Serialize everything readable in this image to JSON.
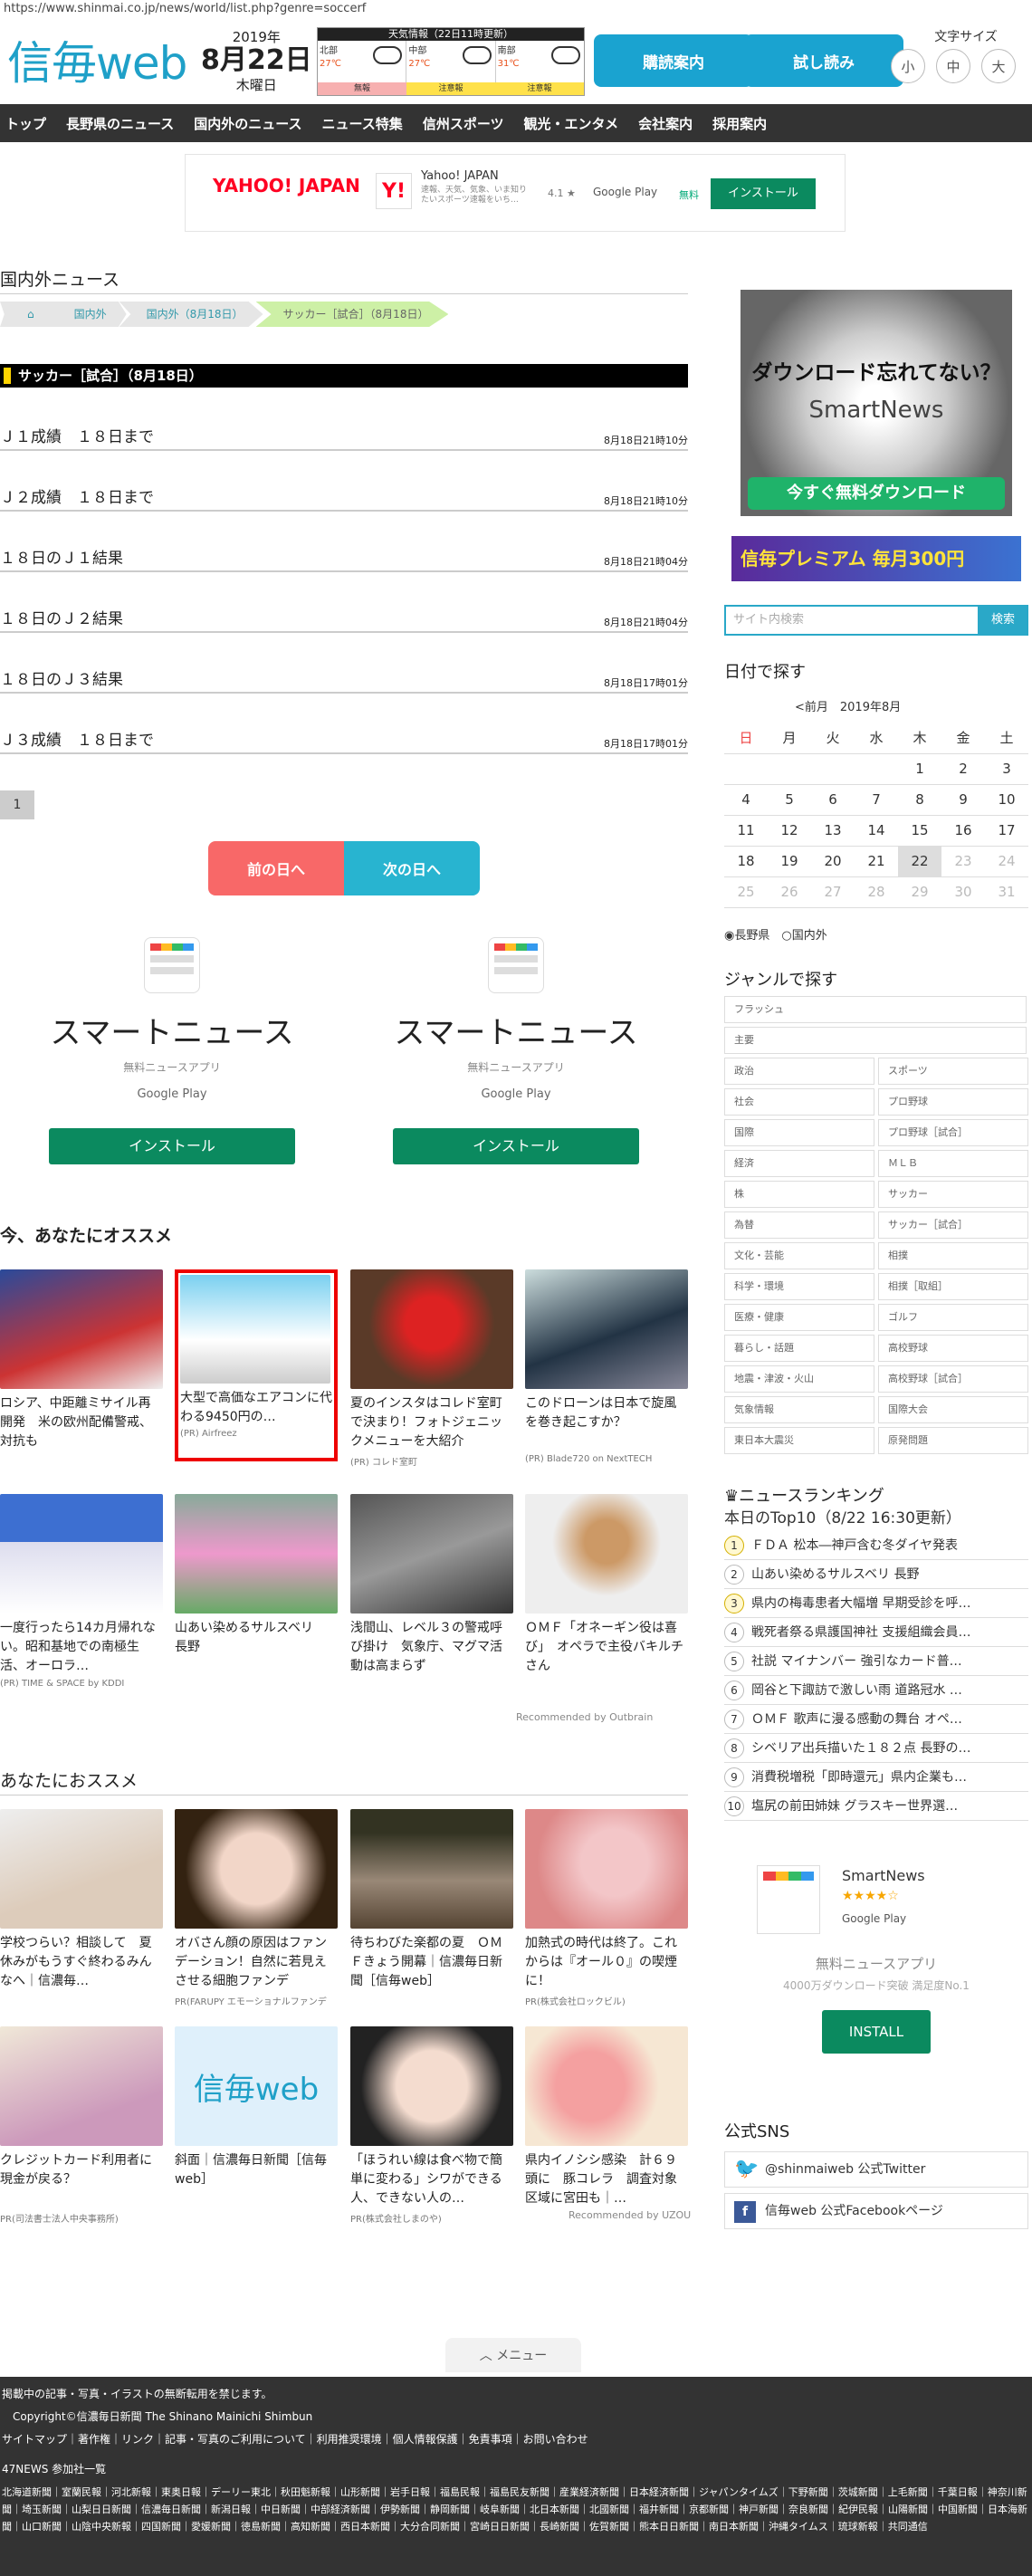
{
  "url": "https://www.shinmai.co.jp/news/world/list.php?genre=soccerf",
  "header": {
    "logo": "信毎web",
    "date_year": "2019年",
    "date_md": "8月22日",
    "date_wd": "木曜日",
    "weather_title": "天気情報（22日11時更新）",
    "weather": [
      {
        "area": "北部",
        "temp": "27℃",
        "warn": "無報"
      },
      {
        "area": "中部",
        "temp": "27℃",
        "warn": "注意報"
      },
      {
        "area": "南部",
        "temp": "31℃",
        "warn": "注意報"
      }
    ],
    "btn_sub": "購読案内",
    "btn_trial": "試し読み",
    "fontsize_label": "文字サイズ",
    "fs_small": "小",
    "fs_mid": "中",
    "fs_large": "大"
  },
  "nav": [
    "トップ",
    "長野県のニュース",
    "国内外のニュース",
    "ニュース特集",
    "信州スポーツ",
    "観光・エンタメ",
    "会社案内",
    "採用案内"
  ],
  "ad_banner": {
    "brand": "YAHOO! JAPAN",
    "app": "Yahoo! JAPAN",
    "desc": "速報、天気、気象、いま知りたいスポーツ速報をいち…",
    "rating": "4.1 ★",
    "store": "Google Play",
    "free": "無料",
    "install": "インストール"
  },
  "main": {
    "section": "国内外ニュース",
    "crumbs": [
      "国内外",
      "国内外（8月18日）",
      "サッカー［試合］（8月18日）"
    ],
    "category_bar": "サッカー［試合］（8月18日）",
    "articles": [
      {
        "title": "Ｊ１成績　１８日まで",
        "date": "8月18日21時10分"
      },
      {
        "title": "Ｊ２成績　１８日まで",
        "date": "8月18日21時10分"
      },
      {
        "title": "１８日のＪ１結果",
        "date": "8月18日21時04分"
      },
      {
        "title": "１８日のＪ２結果",
        "date": "8月18日21時04分"
      },
      {
        "title": "１８日のＪ３結果",
        "date": "8月18日17時01分"
      },
      {
        "title": "Ｊ３成績　１８日まで",
        "date": "8月18日17時01分"
      }
    ],
    "page": "1",
    "prev": "前の日へ",
    "next": "次の日へ",
    "smartnews_ad": {
      "title": "スマートニュース",
      "sub": "無料ニュースアプリ",
      "store": "Google Play",
      "install": "インストール"
    },
    "recommend_title": "今、あなたにオススメ",
    "recommend": [
      {
        "title": "ロシア、中距離ミサイル再開発　米の欧州配備警戒、対抗も",
        "src": ""
      },
      {
        "title": "大型で高価なエアコンに代わる9450円の…",
        "src": "(PR) Airfreez"
      },
      {
        "title": "夏のインスタはコレド室町で決まり！フォトジェニックメニューを大紹介",
        "src": "(PR) コレド室町"
      },
      {
        "title": "このドローンは日本で旋風を巻き起こすか？",
        "src": "(PR) Blade720 on NextTECH"
      },
      {
        "title": "一度行ったら14カ月帰れない。昭和基地での南極生活、オーロラ…",
        "src": "(PR) TIME & SPACE by KDDI"
      },
      {
        "title": "山あい染めるサルスベリ　長野",
        "src": ""
      },
      {
        "title": "浅間山、レベル３の警戒呼び掛け　気象庁、マグマ活動は高まらず",
        "src": ""
      },
      {
        "title": "ＯＭＦ「オネーギン役は喜び」　オペラで主役バキルチさん",
        "src": ""
      }
    ],
    "outbrain": "Recommended by Outbrain",
    "recommend2_title": "あなたにおススメ",
    "recommend2": [
      {
        "title": "学校つらい？相談して　夏休みがもうすぐ終わるみんなへ｜信濃毎…",
        "src": ""
      },
      {
        "title": "オバさん顔の原因はファンデーション！自然に若見えさせる細胞ファンデ",
        "src": "PR(FARUPY エモーショナルファンデ"
      },
      {
        "title": "待ちわびた楽都の夏　ＯＭＦきょう開幕｜信濃毎日新聞［信毎web］",
        "src": ""
      },
      {
        "title": "加熱式の時代は終了。これからは『オール０』の喫煙に！",
        "src": "PR(株式会社ロックビル)"
      },
      {
        "title": "クレジットカード利用者に現金が戻る？",
        "src": "PR(司法書士法人中央事務所)"
      },
      {
        "title": "斜面｜信濃毎日新聞［信毎web］",
        "src": ""
      },
      {
        "title": "「ほうれい線は食べ物で簡単に変わる」シワができる人、できない人の…",
        "src": "PR(株式会社しまのや)"
      },
      {
        "title": "県内イノシシ感染　計６９頭に　豚コレラ　調査対象区域に宮田も｜…",
        "src": ""
      }
    ],
    "uzou": "Recommended by UZOU",
    "menu": "メニュー"
  },
  "side": {
    "sn_ad_title": "ダウンロード忘れてない？",
    "sn_ad_brand": "SmartNews",
    "sn_ad_btn": "今すぐ無料ダウンロード",
    "premium": "信毎プレミアム 毎月300円",
    "search_placeholder": "サイト内検索",
    "search_btn": "検索",
    "date_search": "日付で探す",
    "cal_nav": "<前月　2019年8月",
    "cal_head": [
      "日",
      "月",
      "火",
      "水",
      "木",
      "金",
      "土"
    ],
    "cal_rows": [
      [
        "",
        "",
        "",
        "",
        "1",
        "2",
        "3"
      ],
      [
        "4",
        "5",
        "6",
        "7",
        "8",
        "9",
        "10"
      ],
      [
        "11",
        "12",
        "13",
        "14",
        "15",
        "16",
        "17"
      ],
      [
        "18",
        "19",
        "20",
        "21",
        "22",
        "23",
        "24"
      ],
      [
        "25",
        "26",
        "27",
        "28",
        "29",
        "30",
        "31"
      ]
    ],
    "radio1": "長野県",
    "radio2": "国内外",
    "genre_title": "ジャンルで探す",
    "genre_full": [
      "フラッシュ",
      "主要"
    ],
    "genre_pairs": [
      [
        "政治",
        "スポーツ"
      ],
      [
        "社会",
        "プロ野球"
      ],
      [
        "国際",
        "プロ野球［試合］"
      ],
      [
        "経済",
        "ＭＬＢ"
      ],
      [
        "株",
        "サッカー"
      ],
      [
        "為替",
        "サッカー［試合］"
      ],
      [
        "文化・芸能",
        "相撲"
      ],
      [
        "科学・環境",
        "相撲［取組］"
      ],
      [
        "医療・健康",
        "ゴルフ"
      ],
      [
        "暮らし・話題",
        "高校野球"
      ],
      [
        "地震・津波・火山",
        "高校野球［試合］"
      ],
      [
        "気象情報",
        "国際大会"
      ],
      [
        "東日本大震災",
        "原発問題"
      ]
    ],
    "ranking_title": "ニュースランキング",
    "ranking_sub": "本日のTop10（8/22 16:30更新）",
    "ranking": [
      "ＦＤＡ 松本―神戸含む冬ダイヤ発表",
      "山あい染めるサルスベリ 長野",
      "県内の梅毒患者大幅増 早期受診を呼…",
      "戦死者祭る県護国神社 支援組織会員…",
      "社説 マイナンバー 強引なカード普…",
      "岡谷と下諏訪で激しい雨 道路冠水 …",
      "ＯＭＦ 歌声に漫る感動の舞台 オペ…",
      "シベリア出兵描いた１８２点 長野の…",
      "消費税増税「即時還元」県内企業も…",
      "塩尻の前田姉妹 グラスキー世界選…"
    ],
    "sn2": {
      "name": "SmartNews",
      "stars": "★★★★☆",
      "store": "Google Play",
      "free": "無料ニュースアプリ",
      "dl": "4000万ダウンロード突破 満足度No.1",
      "install": "INSTALL"
    },
    "sns_title": "公式SNS",
    "twitter": "@shinmaiweb 公式Twitter",
    "facebook": "信毎web 公式Facebookページ"
  },
  "footer": {
    "notice": "掲載中の記事・写真・イラストの無断転用を禁じます。",
    "copy": "Copyright©信濃毎日新聞 The Shinano Mainichi Shimbun",
    "links": "サイトマップ｜著作権｜リンク｜記事・写真のご利用について｜利用推奨環境｜個人情報保護｜免責事項｜お問い合わせ",
    "members_title": "47NEWS 参加社一覧",
    "members": "北海道新聞｜室蘭民報｜河北新報｜東奥日報｜デーリー東北｜秋田魁新報｜山形新聞｜岩手日報｜福島民報｜福島民友新聞｜産業経済新聞｜日本経済新聞｜ジャパンタイムズ｜下野新聞｜茨城新聞｜上毛新聞｜千葉日報｜神奈川新聞｜埼玉新聞｜山梨日日新聞｜信濃毎日新聞｜新潟日報｜中日新聞｜中部経済新聞｜伊勢新聞｜静岡新聞｜岐阜新聞｜北日本新聞｜北國新聞｜福井新聞｜京都新聞｜神戸新聞｜奈良新聞｜紀伊民報｜山陽新聞｜中国新聞｜日本海新聞｜山口新聞｜山陰中央新報｜四国新聞｜愛媛新聞｜徳島新聞｜高知新聞｜西日本新聞｜大分合同新聞｜宮崎日日新聞｜長崎新聞｜佐賀新聞｜熊本日日新聞｜南日本新聞｜沖縄タイムス｜琉球新報｜共同通信"
  }
}
